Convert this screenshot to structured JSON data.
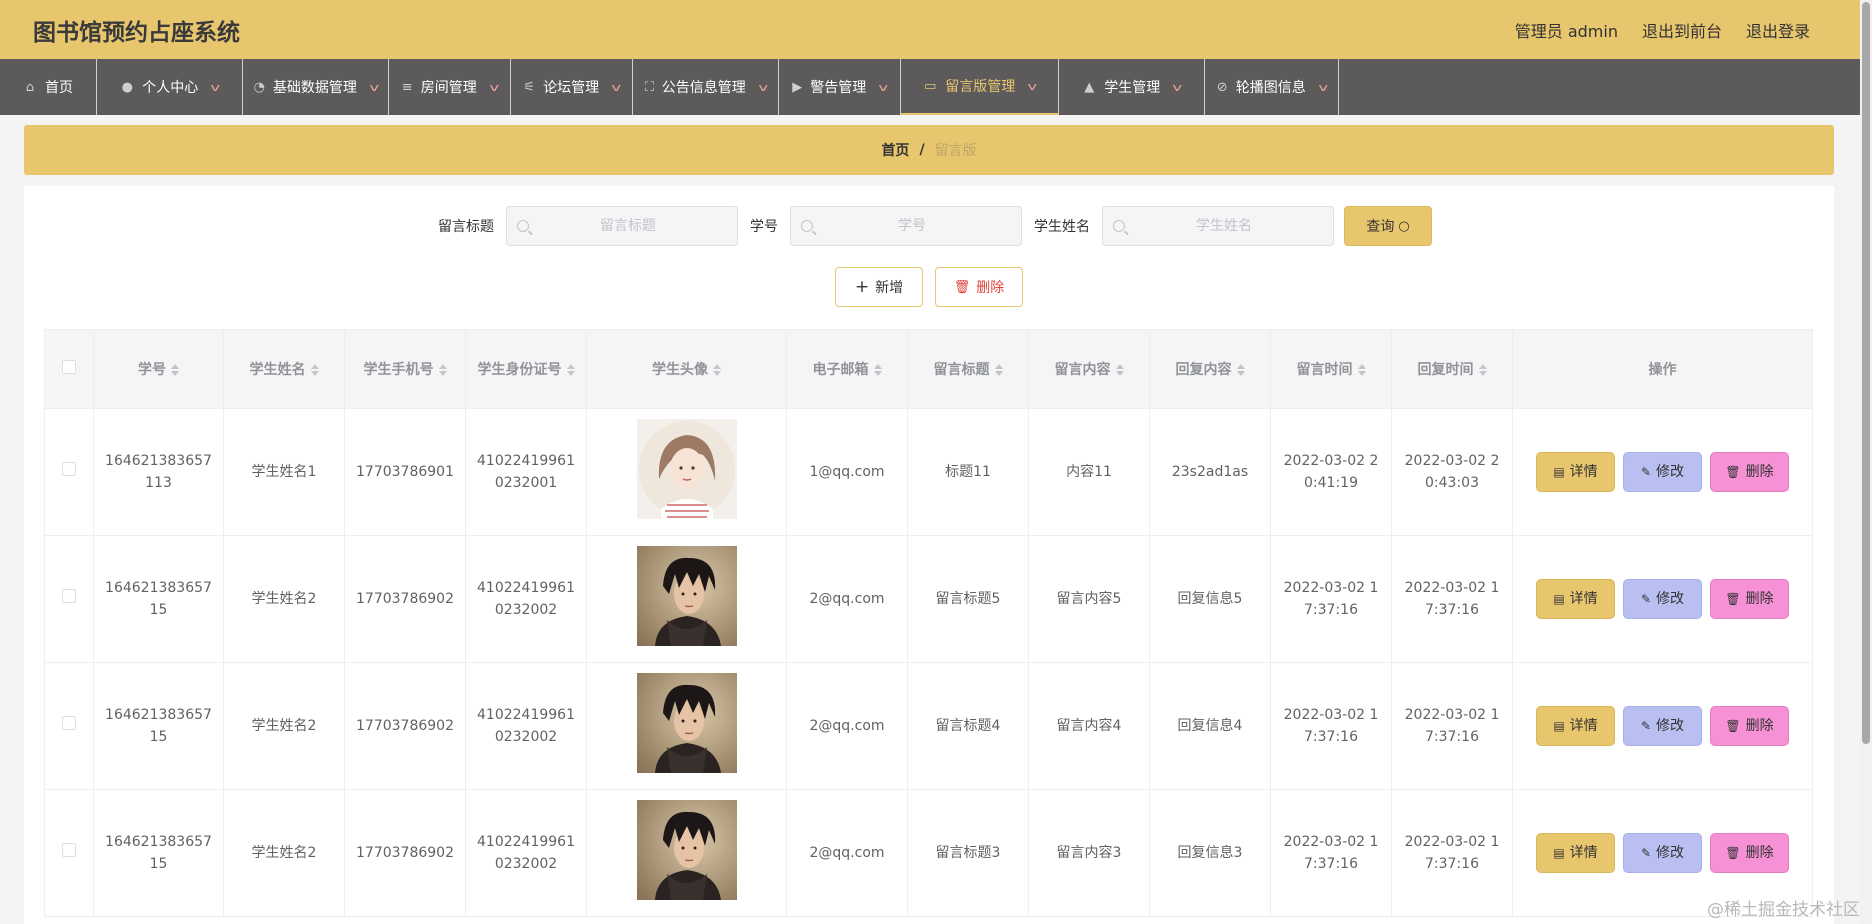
{
  "app": {
    "title": "图书馆预约占座系统",
    "links": [
      "管理员 admin",
      "退出到前台",
      "退出登录"
    ]
  },
  "nav": [
    {
      "label": "首页",
      "icon": "home-icon",
      "has_caret": false,
      "active": false
    },
    {
      "label": "个人中心",
      "icon": "user-icon",
      "has_caret": true,
      "active": false
    },
    {
      "label": "基础数据管理",
      "icon": "dashboard-icon",
      "has_caret": true,
      "active": false
    },
    {
      "label": "房间管理",
      "icon": "list-icon",
      "has_caret": true,
      "active": false
    },
    {
      "label": "论坛管理",
      "icon": "sliders-icon",
      "has_caret": true,
      "active": false
    },
    {
      "label": "公告信息管理",
      "icon": "fullscreen-icon",
      "has_caret": true,
      "active": false
    },
    {
      "label": "警告管理",
      "icon": "video-icon",
      "has_caret": true,
      "active": false
    },
    {
      "label": "留言版管理",
      "icon": "chat-icon",
      "has_caret": true,
      "active": true
    },
    {
      "label": "学生管理",
      "icon": "thumb-icon",
      "has_caret": true,
      "active": false
    },
    {
      "label": "轮播图信息",
      "icon": "bell-off-icon",
      "has_caret": true,
      "active": false
    }
  ],
  "breadcrumb": {
    "home": "首页",
    "sep": "/",
    "current": "留言版"
  },
  "search": {
    "title_label": "留言标题",
    "title_placeholder": "留言标题",
    "id_label": "学号",
    "id_placeholder": "学号",
    "name_label": "学生姓名",
    "name_placeholder": "学生姓名",
    "query_button": "查询"
  },
  "actions": {
    "add": "新增",
    "delete": "删除"
  },
  "table": {
    "columns": [
      "学号",
      "学生姓名",
      "学生手机号",
      "学生身份证号",
      "学生头像",
      "电子邮箱",
      "留言标题",
      "留言内容",
      "回复内容",
      "留言时间",
      "回复时间",
      "操作"
    ],
    "rows": [
      {
        "id": "164621383657113",
        "name": "学生姓名1",
        "phone": "17703786901",
        "idcard": "410224199610232001",
        "avatar": "girl-avatar",
        "email": "1@qq.com",
        "title": "标题11",
        "content": "内容11",
        "reply": "23s2ad1as",
        "msg_time": "2022-03-02 20:41:19",
        "reply_time": "2022-03-02 20:43:03"
      },
      {
        "id": "16462138365715",
        "name": "学生姓名2",
        "phone": "17703786902",
        "idcard": "410224199610232002",
        "avatar": "boy-avatar",
        "email": "2@qq.com",
        "title": "留言标题5",
        "content": "留言内容5",
        "reply": "回复信息5",
        "msg_time": "2022-03-02 17:37:16",
        "reply_time": "2022-03-02 17:37:16"
      },
      {
        "id": "16462138365715",
        "name": "学生姓名2",
        "phone": "17703786902",
        "idcard": "410224199610232002",
        "avatar": "boy-avatar",
        "email": "2@qq.com",
        "title": "留言标题4",
        "content": "留言内容4",
        "reply": "回复信息4",
        "msg_time": "2022-03-02 17:37:16",
        "reply_time": "2022-03-02 17:37:16"
      },
      {
        "id": "16462138365715",
        "name": "学生姓名2",
        "phone": "17703786902",
        "idcard": "410224199610232002",
        "avatar": "boy-avatar",
        "email": "2@qq.com",
        "title": "留言标题3",
        "content": "留言内容3",
        "reply": "回复信息3",
        "msg_time": "2022-03-02 17:37:16",
        "reply_time": "2022-03-02 17:37:16"
      }
    ],
    "row_actions": {
      "detail": "详情",
      "edit": "修改",
      "delete": "删除"
    }
  },
  "colors": {
    "accent": "#e8c66e",
    "nav_bg": "#5c5a5a",
    "edit_btn": "#b9bff0",
    "delete_btn": "#f691d6"
  },
  "watermark": "@稀土掘金技术社区"
}
